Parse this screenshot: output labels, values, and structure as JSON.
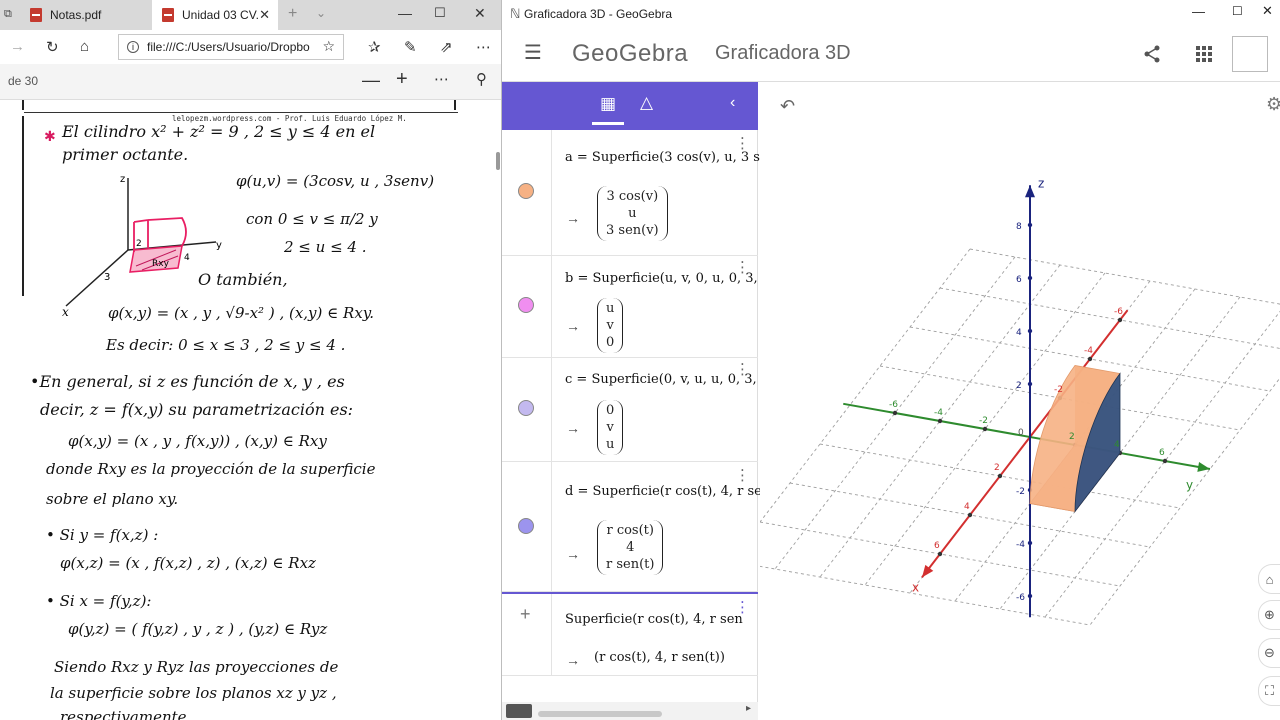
{
  "edge": {
    "tabs": [
      {
        "label": "Notas.pdf"
      },
      {
        "label": "Unidad 03 CV."
      }
    ],
    "address": "file:///C:/Users/Usuario/Dropbo",
    "page_indicator": "de 30",
    "pdf": {
      "header": "lelopezm.wordpress.com - Prof. Luis Eduardo López M.",
      "lines": [
        "El cilindro  x² + z² = 9 ,  2 ≤ y ≤ 4  en el",
        "primer octante.",
        "φ(u,v) = (3cosv, u , 3senv)",
        "con  0 ≤ v ≤ π/2   y",
        "2 ≤ u ≤ 4 .",
        "O también,",
        "φ(x,y) = (x , y , √9-x² ) ,  (x,y) ∈ Rxy.",
        "Es decir:  0 ≤ x ≤ 3 ,  2 ≤ y ≤ 4 .",
        "•En general, si  z  es función de  x, y , es",
        "decir,  z = f(x,y)  su parametrización es:",
        "φ(x,y) = (x , y , f(x,y)) ,   (x,y) ∈ Rxy",
        "donde  Rxy  es la proyección de la superficie",
        "sobre el plano xy.",
        "•  Si   y = f(x,z) :",
        "φ(x,z) = (x , f(x,z) , z) ,   (x,z) ∈ Rxz",
        "•  Si   x = f(y,z):",
        "φ(y,z) = ( f(y,z) , y , z ) ,   (y,z) ∈ Ryz",
        "Siendo  Rxz  y  Ryz  las proyecciones de",
        "la superficie sobre los planos  xz  y  yz ,",
        "respectivamente."
      ],
      "sketch_labels": [
        "z",
        "y",
        "x",
        "3",
        "2",
        "4",
        "Rxy"
      ]
    }
  },
  "geogebra": {
    "window_title": "Graficadora 3D - GeoGebra",
    "logo": "GeoGebra",
    "app_name": "Graficadora 3D",
    "rows": [
      {
        "input": "a = Superficie(3 cos(v), u, 3 se",
        "output": [
          "3 cos(v)",
          "u",
          "3 sen(v)"
        ],
        "color": "#f6b184"
      },
      {
        "input": "b = Superficie(u, v, 0, u, 0, 3, v",
        "output": [
          "u",
          "v",
          "0"
        ],
        "color": "#f08ef0"
      },
      {
        "input": "c = Superficie(0, v, u, u, 0, 3, v",
        "output": [
          "0",
          "v",
          "u"
        ],
        "color": "#c3b9ef"
      },
      {
        "input": "d = Superficie(r cos(t), 4, r se",
        "output": [
          "r cos(t)",
          "4",
          "r sen(t)"
        ],
        "color": "#9c94ee"
      }
    ],
    "input_row": {
      "input": "Superficie(r cos(t), 4, r sen",
      "output": "(r cos(t), 4, r sen(t))"
    },
    "axis_labels": {
      "z": "z",
      "y": "y",
      "x": "x"
    },
    "ticks": {
      "z": [
        "8",
        "6",
        "4",
        "2",
        "0",
        "-2",
        "-4",
        "-6"
      ],
      "y": [
        "-6",
        "-4",
        "-2",
        "2",
        "4",
        "6"
      ],
      "x": [
        "-6",
        "-4",
        "-2",
        "2",
        "4",
        "6"
      ]
    },
    "colors": {
      "accent": "#6557d2",
      "x_axis": "#d32f2f",
      "y_axis": "#2e8b2e",
      "z_axis": "#1a237e"
    }
  }
}
